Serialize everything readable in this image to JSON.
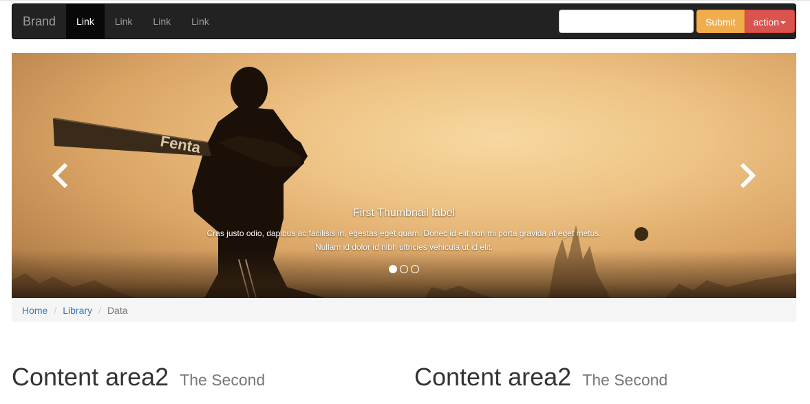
{
  "navbar": {
    "brand": "Brand",
    "links": [
      "Link",
      "Link",
      "Link",
      "Link"
    ],
    "search_placeholder": "",
    "submit_label": "Submit",
    "action_label": "action"
  },
  "carousel": {
    "caption_title": "First Thumbnail label",
    "caption_text_line1": "Cras justo odio, dapibus ac facilisis in, egestas eget quam. Donec id elit non mi porta gravida at eget metus.",
    "caption_text_line2": "Nullam id dolor id nibh ultricies vehicula ut id elit.",
    "slides_count": 3,
    "active_slide": 1,
    "bat_text": "Fenta"
  },
  "breadcrumb": {
    "items": [
      "Home",
      "Library"
    ],
    "active": "Data",
    "separator": "/"
  },
  "content": [
    {
      "title": "Content area2",
      "subtitle": "The Second"
    },
    {
      "title": "Content area2",
      "subtitle": "The Second"
    }
  ],
  "colors": {
    "navbar_bg": "#222222",
    "submit": "#f0ad4e",
    "action": "#d9534f",
    "link": "#337ab7"
  }
}
